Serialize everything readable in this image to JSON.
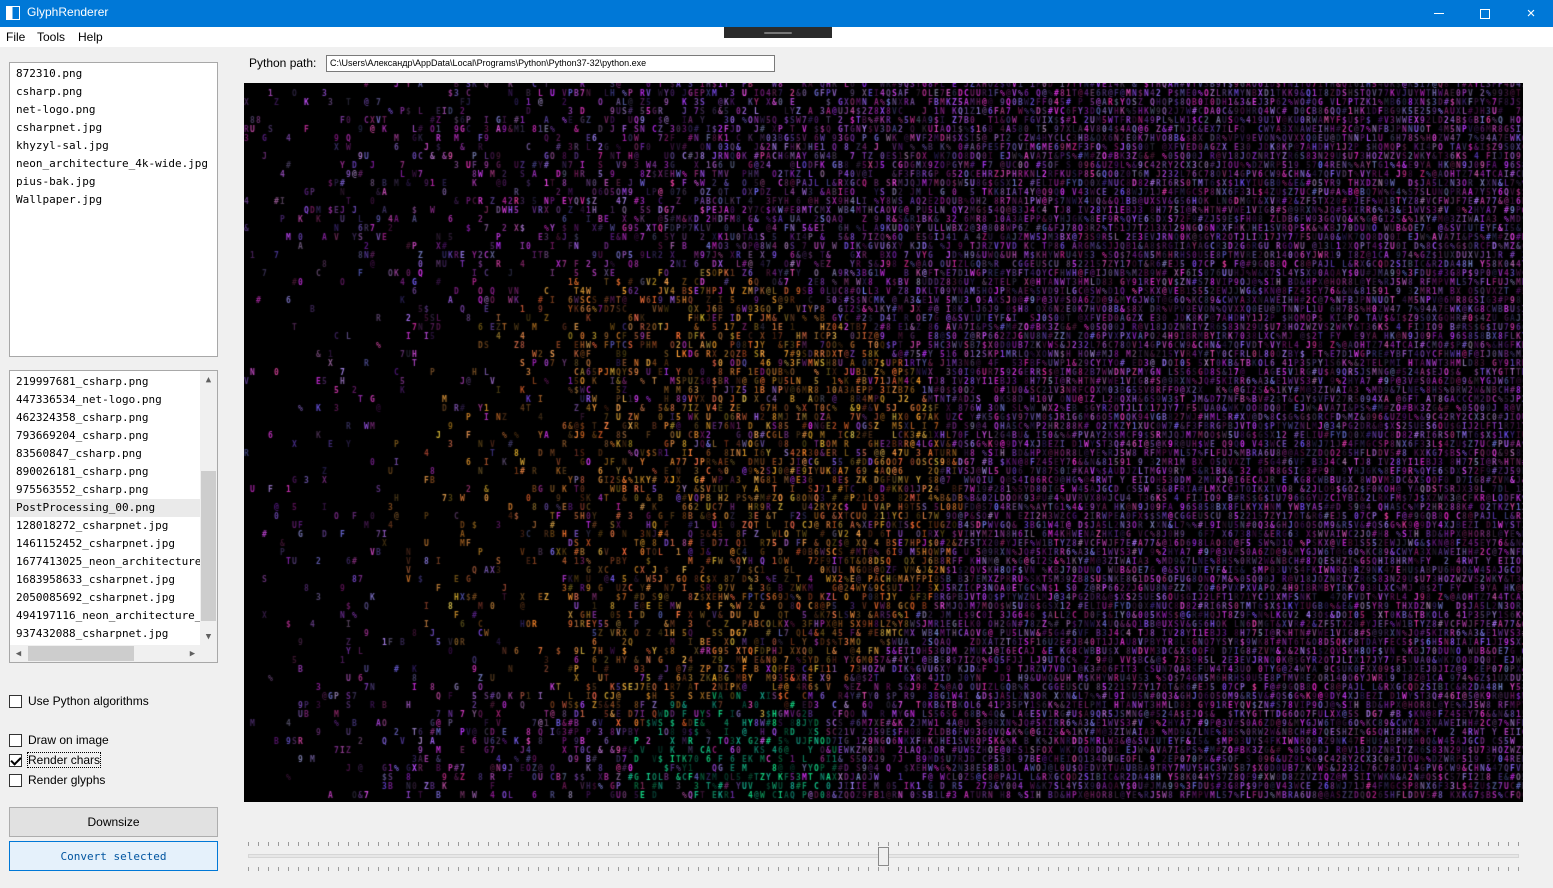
{
  "window": {
    "title": "GlyphRenderer",
    "minimize_glyph": "minimize-icon",
    "maximize_glyph": "maximize-icon",
    "close_glyph": "×"
  },
  "menu": [
    {
      "label": "File"
    },
    {
      "label": "Tools"
    },
    {
      "label": "Help"
    }
  ],
  "source_files": [
    "872310.png",
    "csharp.png",
    "net-logo.png",
    "csharpnet.jpg",
    "khyzyl-sal.jpg",
    "neon_architecture_4k-wide.jpg",
    "pius-bak.jpg",
    "Wallpaper.jpg"
  ],
  "output_files": [
    "219997681_csharp.png",
    "447336534_net-logo.png",
    "462324358_csharp.png",
    "793669204_csharp.png",
    "83560847_csharp.png",
    "890026181_csharp.png",
    "975563552_csharp.png",
    "PostProcessing_00.png",
    "128018272_csharpnet.jpg",
    "1461152452_csharpnet.jpg",
    "1677413025_neon_architecture",
    "1683958633_csharpnet.jpg",
    "2050085692_csharpnet.jpg",
    "494197116_neon_architecture_",
    "937432088_csharpnet.jpg"
  ],
  "selected_output": "PostProcessing_00.png",
  "options": {
    "use_python": {
      "label": "Use Python algorithms",
      "checked": false
    },
    "draw_on_image": {
      "label": "Draw on image",
      "checked": false
    },
    "render_chars": {
      "label": "Render chars",
      "checked": true
    },
    "render_glyphs": {
      "label": "Render glyphs",
      "checked": false
    }
  },
  "buttons": {
    "downsize": "Downsize",
    "convert": "Convert selected"
  },
  "python_path": {
    "label": "Python path:",
    "value": "C:\\Users\\Александр\\AppData\\Local\\Programs\\Python\\Python37-32\\python.exe"
  },
  "slider": {
    "value_fraction": 0.5
  },
  "colors": {
    "titlebar": "#0078d7",
    "accent": "#0078d7",
    "preview_bg": "#000000"
  }
}
